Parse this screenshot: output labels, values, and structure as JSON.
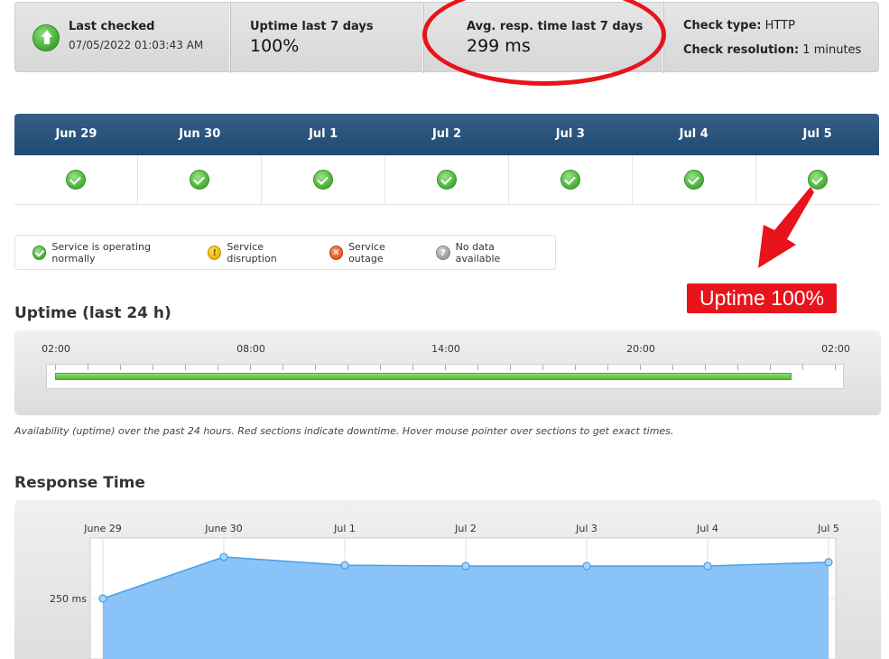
{
  "summary": {
    "last_checked_label": "Last checked",
    "last_checked_value": "07/05/2022 01:03:43 AM",
    "uptime_label": "Uptime last 7 days",
    "uptime_value": "100%",
    "avg_resp_label": "Avg. resp. time last 7 days",
    "avg_resp_value": "299 ms",
    "check_type_label": "Check type:",
    "check_type_value": "HTTP",
    "check_resolution_label": "Check resolution:",
    "check_resolution_value": "1 minutes",
    "status_icon": "arrow-up-icon"
  },
  "days": [
    {
      "label": "Jun 29",
      "status": "ok"
    },
    {
      "label": "Jun 30",
      "status": "ok"
    },
    {
      "label": "Jul 1",
      "status": "ok"
    },
    {
      "label": "Jul 2",
      "status": "ok"
    },
    {
      "label": "Jul 3",
      "status": "ok"
    },
    {
      "label": "Jul 4",
      "status": "ok"
    },
    {
      "label": "Jul 5",
      "status": "ok"
    }
  ],
  "legend": {
    "ok": "Service is operating normally",
    "disruption": "Service disruption",
    "outage": "Service outage",
    "nodata": "No data available"
  },
  "annotation": {
    "text": "Uptime 100%",
    "color": "#e8131b"
  },
  "uptime24": {
    "title": "Uptime (last 24 h)",
    "ticks": [
      "02:00",
      "08:00",
      "14:00",
      "20:00",
      "02:00"
    ],
    "uptime_fraction": 0.945,
    "caption": "Availability (uptime) over the past 24 hours. Red sections indicate downtime. Hover mouse pointer over sections to get exact times."
  },
  "response": {
    "title": "Response Time",
    "y_tick_label": "250 ms"
  },
  "chart_data": {
    "type": "area",
    "categories": [
      "June 29",
      "June 30",
      "Jul 1",
      "Jul 2",
      "Jul 3",
      "Jul 4",
      "Jul 5"
    ],
    "values": [
      250,
      305,
      294,
      293,
      293,
      293,
      298
    ],
    "ylabel": "",
    "y_ticks": [
      250
    ],
    "grid": true,
    "colors": {
      "fill": "#7cbdf7",
      "line": "#4a9ee6"
    }
  }
}
